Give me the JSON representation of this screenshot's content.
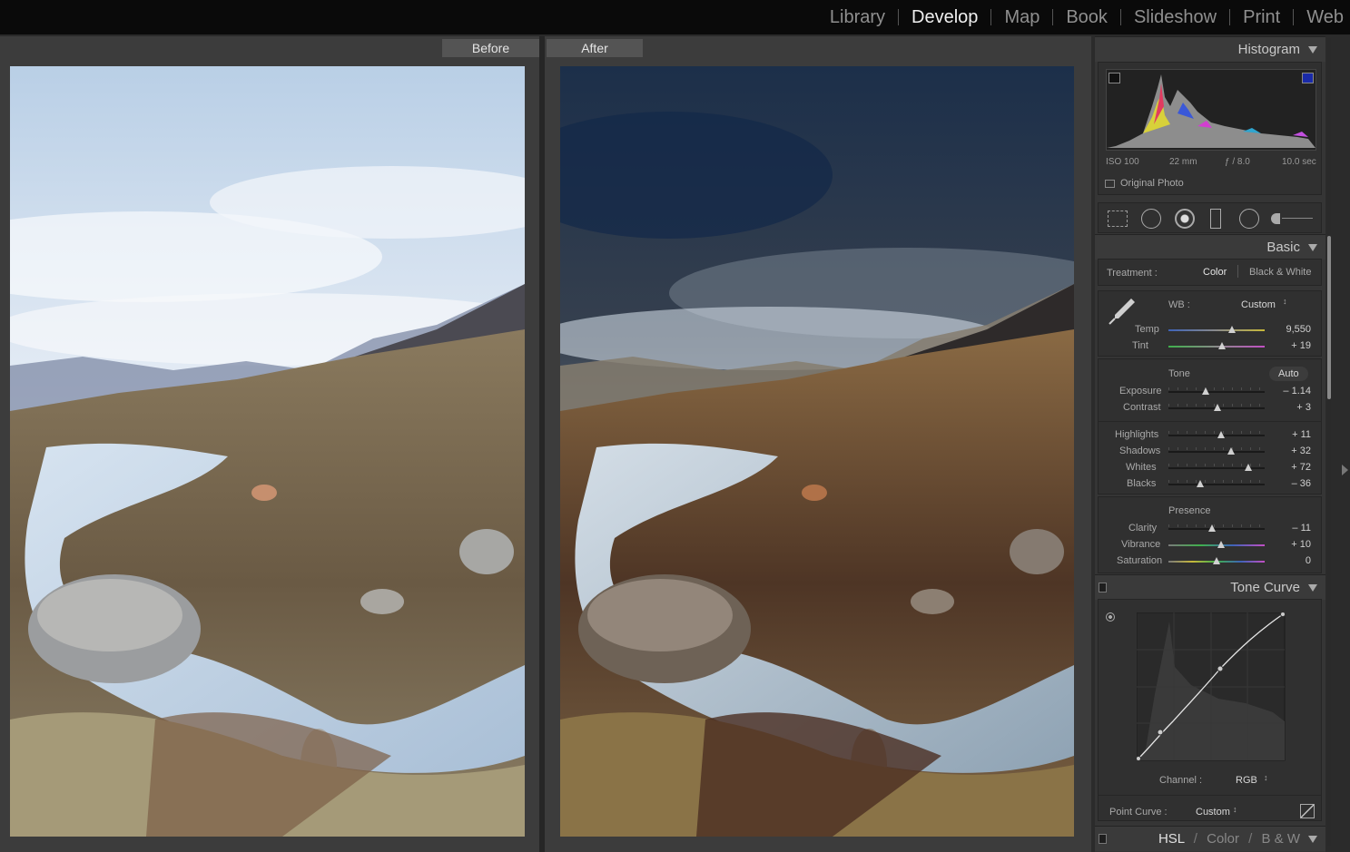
{
  "modules": [
    "Library",
    "Develop",
    "Map",
    "Book",
    "Slideshow",
    "Print",
    "Web"
  ],
  "active_module": "Develop",
  "compare": {
    "before_label": "Before",
    "after_label": "After"
  },
  "histogram": {
    "title": "Histogram",
    "iso": "ISO 100",
    "focal": "22 mm",
    "aperture": "ƒ / 8.0",
    "shutter": "10.0 sec",
    "original_photo_label": "Original Photo"
  },
  "basic": {
    "title": "Basic",
    "treatment_label": "Treatment :",
    "treatment_color": "Color",
    "treatment_bw": "Black & White",
    "wb_label": "WB :",
    "wb_value": "Custom",
    "temp": {
      "label": "Temp",
      "value": "9,550",
      "position": 0.66
    },
    "tint": {
      "label": "Tint",
      "value": "+ 19",
      "position": 0.56
    },
    "tone_label": "Tone",
    "auto_label": "Auto",
    "exposure": {
      "label": "Exposure",
      "value": "– 1.14",
      "position": 0.39
    },
    "contrast": {
      "label": "Contrast",
      "value": "+ 3",
      "position": 0.51
    },
    "highlights": {
      "label": "Highlights",
      "value": "+ 11",
      "position": 0.55
    },
    "shadows": {
      "label": "Shadows",
      "value": "+ 32",
      "position": 0.65
    },
    "whites": {
      "label": "Whites",
      "value": "+ 72",
      "position": 0.83
    },
    "blacks": {
      "label": "Blacks",
      "value": "– 36",
      "position": 0.33
    },
    "presence_label": "Presence",
    "clarity": {
      "label": "Clarity",
      "value": "– 11",
      "position": 0.45
    },
    "vibrance": {
      "label": "Vibrance",
      "value": "+ 10",
      "position": 0.55
    },
    "saturation": {
      "label": "Saturation",
      "value": "0",
      "position": 0.5
    }
  },
  "tone_curve": {
    "title": "Tone Curve",
    "channel_label": "Channel :",
    "channel_value": "RGB",
    "point_curve_label": "Point Curve :",
    "point_curve_value": "Custom"
  },
  "hsl": {
    "hsl": "HSL",
    "sep1": "/",
    "color": "Color",
    "sep2": "/",
    "bw": "B & W"
  },
  "colors": {
    "active_module": "#f0f0f0",
    "inactive_module": "#8f8f8f",
    "panel": "#353535"
  }
}
